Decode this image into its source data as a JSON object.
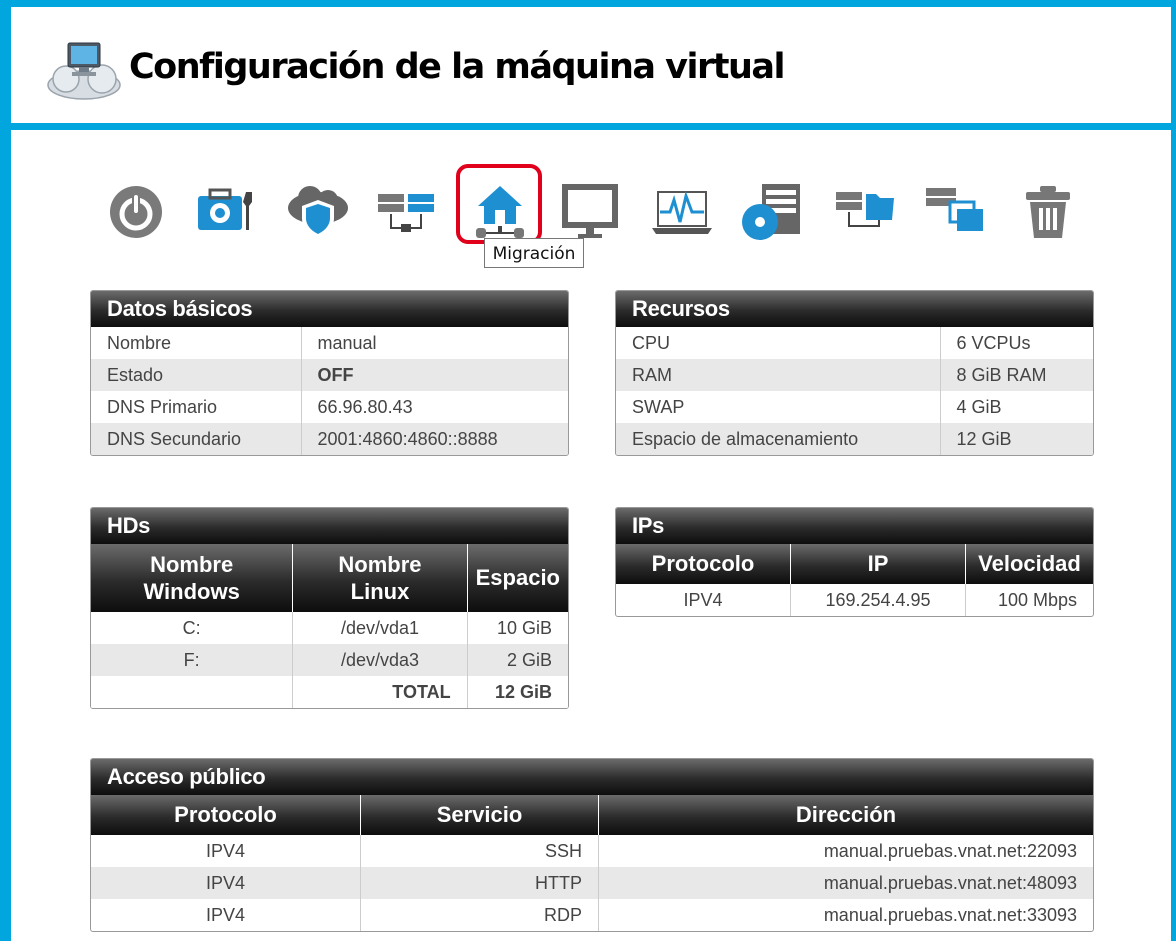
{
  "header": {
    "title": "Configuración de la máquina virtual",
    "logo_icon": "cloud-computer-icon"
  },
  "toolbar": {
    "icons": [
      "power-icon",
      "maintenance-toolbox-icon",
      "cloud-shield-icon",
      "network-servers-icon",
      "migration-home-icon",
      "monitor-icon",
      "monitoring-heartbeat-icon",
      "disk-server-icon",
      "server-folder-icon",
      "server-snapshots-icon",
      "trash-icon"
    ],
    "selected": "migration-home-icon",
    "tooltip": "Migración",
    "accent_color": "#00a6dd",
    "selected_color": "#e0001b"
  },
  "basic": {
    "title": "Datos básicos",
    "rows": [
      {
        "k": "Nombre",
        "v": "manual"
      },
      {
        "k": "Estado",
        "v": "OFF"
      },
      {
        "k": "DNS Primario",
        "v": "66.96.80.43"
      },
      {
        "k": "DNS Secundario",
        "v": "2001:4860:4860::8888"
      }
    ]
  },
  "resources": {
    "title": "Recursos",
    "rows": [
      {
        "k": "CPU",
        "v": "6 VCPUs"
      },
      {
        "k": "RAM",
        "v": "8 GiB RAM"
      },
      {
        "k": "SWAP",
        "v": "4 GiB"
      },
      {
        "k": "Espacio de almacenamiento",
        "v": "12 GiB"
      }
    ]
  },
  "hds": {
    "title": "HDs",
    "headers": {
      "win_1": "Nombre",
      "win_2": "Windows",
      "lin_1": "Nombre",
      "lin_2": "Linux",
      "space": "Espacio"
    },
    "rows": [
      {
        "win": "C:",
        "lin": "/dev/vda1",
        "space": "10 GiB"
      },
      {
        "win": "F:",
        "lin": "/dev/vda3",
        "space": "2 GiB"
      }
    ],
    "total_label": "TOTAL",
    "total_value": "12 GiB"
  },
  "ips": {
    "title": "IPs",
    "headers": {
      "proto": "Protocolo",
      "ip": "IP",
      "speed": "Velocidad"
    },
    "rows": [
      {
        "proto": "IPV4",
        "ip": "169.254.4.95",
        "speed": "100 Mbps"
      }
    ]
  },
  "public": {
    "title": "Acceso público",
    "headers": {
      "proto": "Protocolo",
      "service": "Servicio",
      "address": "Dirección"
    },
    "rows": [
      {
        "proto": "IPV4",
        "service": "SSH",
        "address": "manual.pruebas.vnat.net:22093"
      },
      {
        "proto": "IPV4",
        "service": "HTTP",
        "address": "manual.pruebas.vnat.net:48093"
      },
      {
        "proto": "IPV4",
        "service": "RDP",
        "address": "manual.pruebas.vnat.net:33093"
      }
    ]
  }
}
